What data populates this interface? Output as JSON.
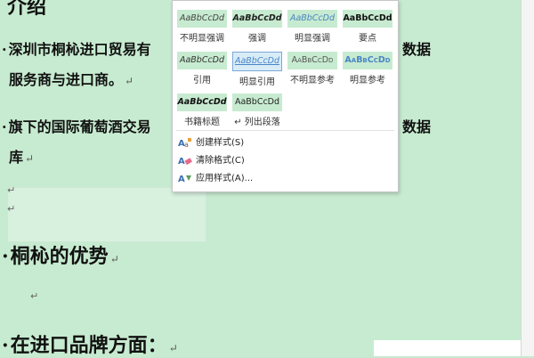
{
  "document": {
    "heading_partial": "介绍",
    "para1_line1": "深圳市桐杺进口贸易有",
    "para1_right": "数据",
    "para1_line2": "服务商与进口商。",
    "para2_line1": "旗下的国际葡萄酒交易",
    "para2_right": "数据",
    "para2_line2": "库",
    "heading2": "桐杺的优势",
    "heading3": "在进口品牌方面：",
    "bullet": "·",
    "para_mark": "↵"
  },
  "styles_gallery": {
    "tiles": [
      {
        "preview": "AaBbCcDd",
        "caption": "不明显强调"
      },
      {
        "preview": "AaBbCcDd",
        "caption": "强调"
      },
      {
        "preview": "AaBbCcDd",
        "caption": "明显强调"
      },
      {
        "preview": "AaBbCcDd",
        "caption": "要点"
      },
      {
        "preview": "AaBbCcDd",
        "caption": "引用"
      },
      {
        "preview": "AaBbCcDd",
        "caption": "明显引用"
      },
      {
        "preview": "AaBbCcDd",
        "caption": "不明显参考"
      },
      {
        "preview": "AaBbCcDd",
        "caption": "明显参考"
      },
      {
        "preview": "AaBbCcDd",
        "caption": "书籍标题"
      },
      {
        "preview": "AaBbCcDd",
        "caption": "↵ 列出段落"
      }
    ],
    "menu": [
      {
        "label": "创建样式(S)",
        "icon": "create-style-icon"
      },
      {
        "label": "清除格式(C)",
        "icon": "clear-format-icon"
      },
      {
        "label": "应用样式(A)...",
        "icon": "apply-styles-icon"
      }
    ]
  },
  "colors": {
    "document_bg": "#c7ebd0",
    "accent": "#4a86c5"
  }
}
